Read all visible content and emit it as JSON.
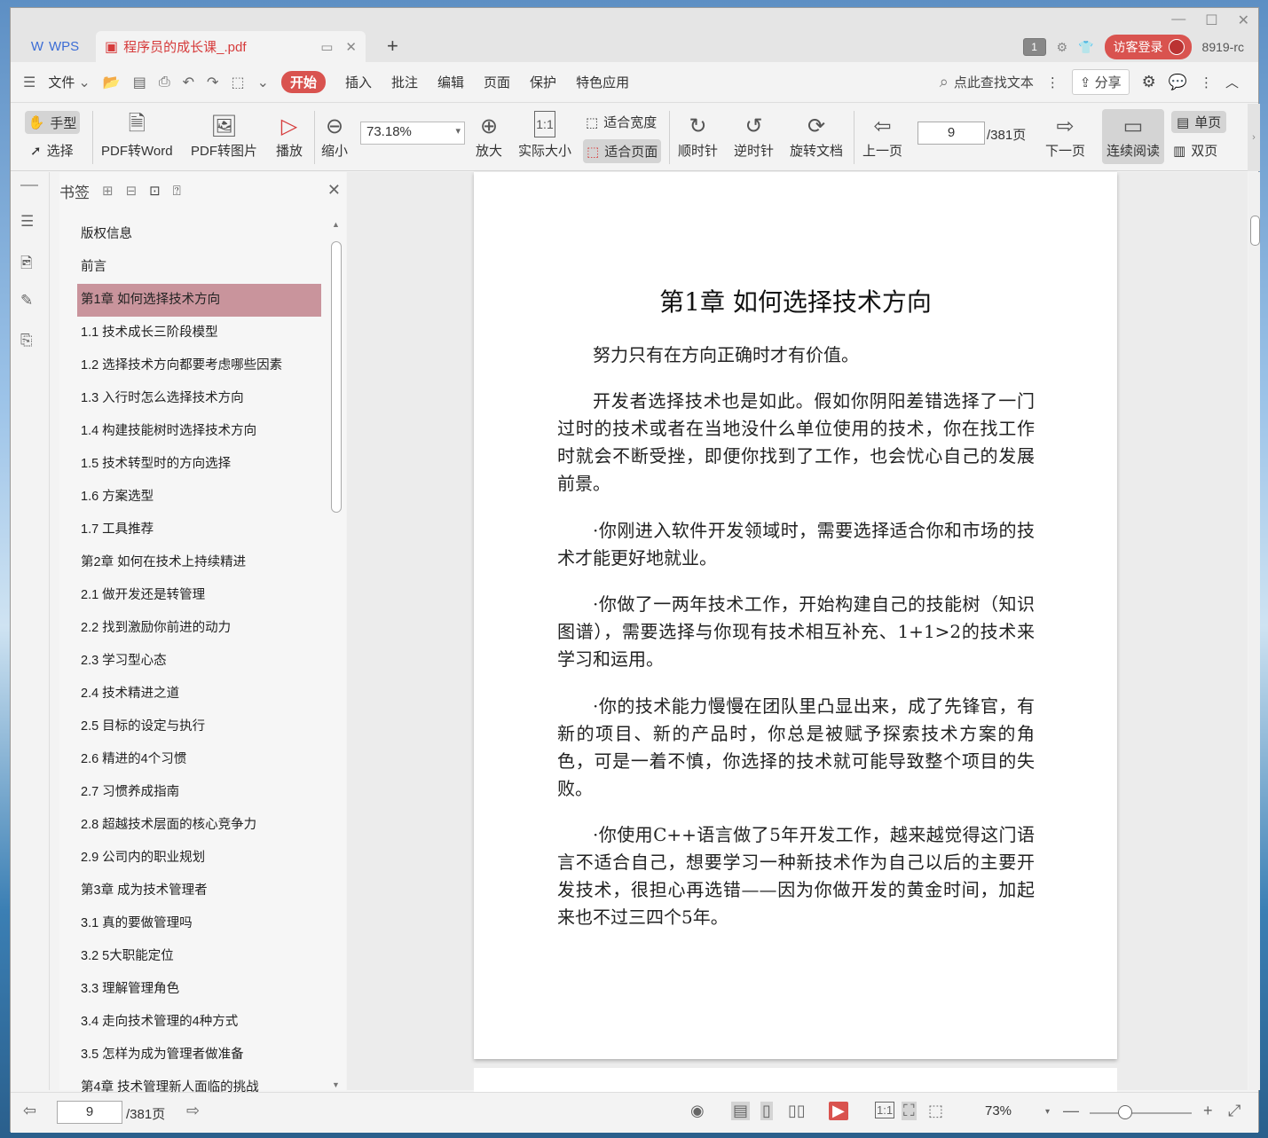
{
  "titlebar": {
    "wps_label": "WPS",
    "doc_tab": "程序员的成长课_.pdf",
    "page_count_badge": "1",
    "visitor_login": "访客登录",
    "user": "8919-rc"
  },
  "menubar": {
    "file": "文件",
    "items": [
      "开始",
      "插入",
      "批注",
      "编辑",
      "页面",
      "保护",
      "特色应用"
    ],
    "search": "点此查找文本",
    "share": "分享"
  },
  "toolbar": {
    "hand": "手型",
    "select": "选择",
    "pdf_to_word": "PDF转Word",
    "pdf_to_image": "PDF转图片",
    "play": "播放",
    "zoom_out": "缩小",
    "zoom_value": "73.18%",
    "zoom_in": "放大",
    "actual_size": "实际大小",
    "fit_width": "适合宽度",
    "fit_page": "适合页面",
    "clockwise": "顺时针",
    "counterclockwise": "逆时针",
    "rotate_doc": "旋转文档",
    "prev_page": "上一页",
    "page_current": "9",
    "page_total": "/381页",
    "next_page": "下一页",
    "continuous": "连续阅读",
    "single": "单页",
    "double": "双页"
  },
  "sidebar": {
    "title": "书签",
    "items": [
      "版权信息",
      "前言",
      "第1章 如何选择技术方向",
      "1.1 技术成长三阶段模型",
      "1.2 选择技术方向都要考虑哪些因素",
      "1.3 入行时怎么选择技术方向",
      "1.4 构建技能树时选择技术方向",
      "1.5 技术转型时的方向选择",
      "1.6 方案选型",
      "1.7 工具推荐",
      "第2章 如何在技术上持续精进",
      "2.1 做开发还是转管理",
      "2.2 找到激励你前进的动力",
      "2.3 学习型心态",
      "2.4 技术精进之道",
      "2.5 目标的设定与执行",
      "2.6 精进的4个习惯",
      "2.7 习惯养成指南",
      "2.8 超越技术层面的核心竞争力",
      "2.9 公司内的职业规划",
      "第3章 成为技术管理者",
      "3.1 真的要做管理吗",
      "3.2 5大职能定位",
      "3.3 理解管理角色",
      "3.4 走向技术管理的4种方式",
      "3.5 怎样为成为管理者做准备",
      "第4章 技术管理新人面临的挑战"
    ],
    "active_index": 2
  },
  "page": {
    "chapter_title": "第1章 如何选择技术方向",
    "paragraphs": [
      "努力只有在方向正确时才有价值。",
      "开发者选择技术也是如此。假如你阴阳差错选择了一门过时的技术或者在当地没什么单位使用的技术，你在找工作时就会不断受挫，即便你找到了工作，也会忧心自己的发展前景。",
      "·你刚进入软件开发领域时，需要选择适合你和市场的技术才能更好地就业。",
      "·你做了一两年技术工作，开始构建自己的技能树（知识图谱），需要选择与你现有技术相互补充、1+1>2的技术来学习和运用。",
      "·你的技术能力慢慢在团队里凸显出来，成了先锋官，有新的项目、新的产品时，你总是被赋予探索技术方案的角色，可是一着不慎，你选择的技术就可能导致整个项目的失败。",
      "·你使用C++语言做了5年开发工作，越来越觉得这门语言不适合自己，想要学习一种新技术作为自己以后的主要开发技术，很担心再选错——因为你做开发的黄金时间，加起来也不过三四个5年。"
    ]
  },
  "statusbar": {
    "page_current": "9",
    "page_total": "/381页",
    "zoom": "73%"
  }
}
